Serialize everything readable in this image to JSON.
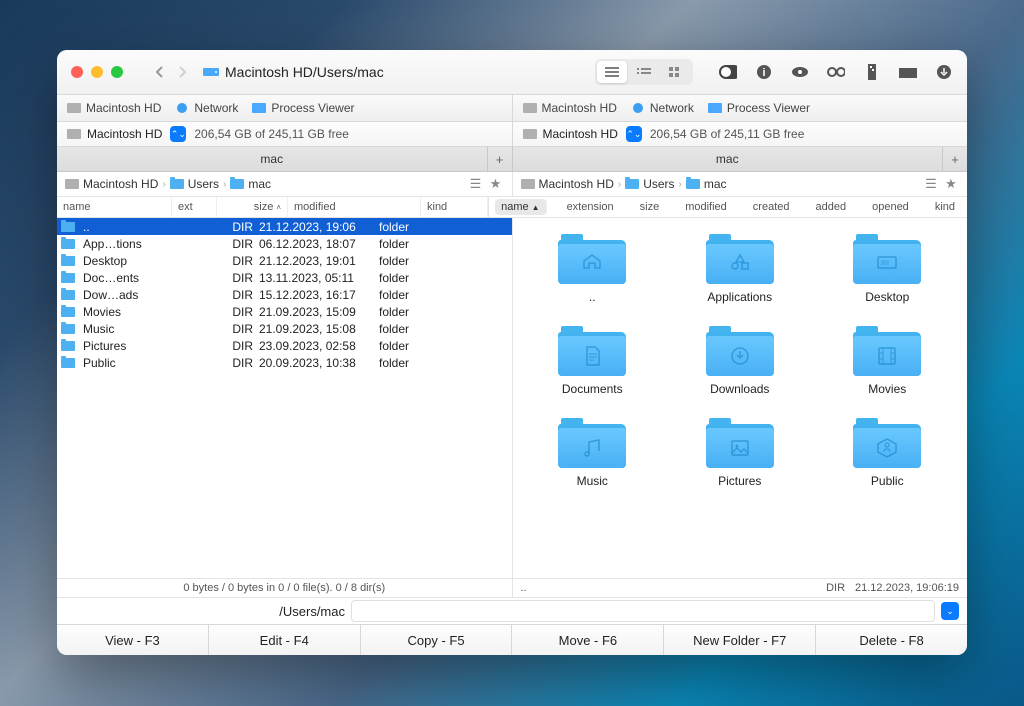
{
  "window": {
    "title": "Macintosh HD/Users/mac"
  },
  "subbar": {
    "drive": "Macintosh HD",
    "network": "Network",
    "process": "Process Viewer"
  },
  "drivebar": {
    "drive": "Macintosh HD",
    "freespace": "206,54 GB of 245,11 GB free"
  },
  "tab": "mac",
  "breadcrumb": {
    "drive": "Macintosh HD",
    "users": "Users",
    "mac": "mac"
  },
  "left": {
    "headers": {
      "name": "name",
      "ext": "ext",
      "size": "size",
      "modified": "modified",
      "kind": "kind"
    },
    "rows": [
      {
        "name": "..",
        "size": "DIR",
        "mod": "21.12.2023, 19:06",
        "kind": "folder",
        "sel": true
      },
      {
        "name": "App…tions",
        "size": "DIR",
        "mod": "06.12.2023, 18:07",
        "kind": "folder"
      },
      {
        "name": "Desktop",
        "size": "DIR",
        "mod": "21.12.2023, 19:01",
        "kind": "folder"
      },
      {
        "name": "Doc…ents",
        "size": "DIR",
        "mod": "13.11.2023, 05:11",
        "kind": "folder"
      },
      {
        "name": "Dow…ads",
        "size": "DIR",
        "mod": "15.12.2023, 16:17",
        "kind": "folder"
      },
      {
        "name": "Movies",
        "size": "DIR",
        "mod": "21.09.2023, 15:09",
        "kind": "folder"
      },
      {
        "name": "Music",
        "size": "DIR",
        "mod": "21.09.2023, 15:08",
        "kind": "folder"
      },
      {
        "name": "Pictures",
        "size": "DIR",
        "mod": "23.09.2023, 02:58",
        "kind": "folder"
      },
      {
        "name": "Public",
        "size": "DIR",
        "mod": "20.09.2023, 10:38",
        "kind": "folder"
      }
    ],
    "status": "0 bytes / 0 bytes in 0 / 0 file(s). 0 / 8 dir(s)"
  },
  "right": {
    "headers": {
      "name": "name",
      "extension": "extension",
      "size": "size",
      "modified": "modified",
      "created": "created",
      "added": "added",
      "opened": "opened",
      "kind": "kind"
    },
    "items": [
      {
        "name": "..",
        "icon": "home"
      },
      {
        "name": "Applications",
        "icon": "apps"
      },
      {
        "name": "Desktop",
        "icon": "desktop"
      },
      {
        "name": "Documents",
        "icon": "doc"
      },
      {
        "name": "Downloads",
        "icon": "download"
      },
      {
        "name": "Movies",
        "icon": "film"
      },
      {
        "name": "Music",
        "icon": "music"
      },
      {
        "name": "Pictures",
        "icon": "picture"
      },
      {
        "name": "Public",
        "icon": "public"
      }
    ],
    "status_parent": "..",
    "status_dir": "DIR",
    "status_date": "21.12.2023, 19:06:19"
  },
  "path": "/Users/mac",
  "footer": {
    "view": "View - F3",
    "edit": "Edit - F4",
    "copy": "Copy - F5",
    "move": "Move - F6",
    "newfolder": "New Folder - F7",
    "delete": "Delete - F8"
  }
}
